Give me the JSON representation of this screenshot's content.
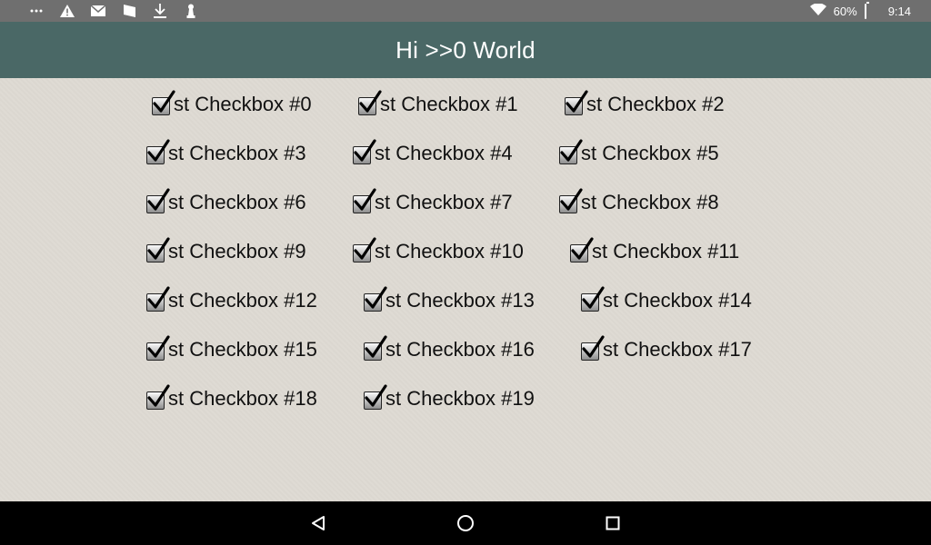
{
  "status_bar": {
    "icons_left": [
      "more-icon",
      "warning-icon",
      "mail-icon",
      "flag-icon",
      "download-icon",
      "chess-pawn-icon"
    ],
    "battery_percent": "60%",
    "time": "9:14"
  },
  "app_bar": {
    "title": "Hi >>0 World"
  },
  "checkboxes": [
    {
      "label": "st Checkbox #0",
      "checked": true
    },
    {
      "label": "st Checkbox #1",
      "checked": true
    },
    {
      "label": "st Checkbox #2",
      "checked": true
    },
    {
      "label": "st Checkbox #3",
      "checked": true
    },
    {
      "label": "st Checkbox #4",
      "checked": true
    },
    {
      "label": "st Checkbox #5",
      "checked": true
    },
    {
      "label": "st Checkbox #6",
      "checked": true
    },
    {
      "label": "st Checkbox #7",
      "checked": true
    },
    {
      "label": "st Checkbox #8",
      "checked": true
    },
    {
      "label": "st Checkbox #9",
      "checked": true
    },
    {
      "label": "st Checkbox #10",
      "checked": true
    },
    {
      "label": "st Checkbox #11",
      "checked": true
    },
    {
      "label": "st Checkbox #12",
      "checked": true
    },
    {
      "label": "st Checkbox #13",
      "checked": true
    },
    {
      "label": "st Checkbox #14",
      "checked": true
    },
    {
      "label": "st Checkbox #15",
      "checked": true
    },
    {
      "label": "st Checkbox #16",
      "checked": true
    },
    {
      "label": "st Checkbox #17",
      "checked": true
    },
    {
      "label": "st Checkbox #18",
      "checked": true
    },
    {
      "label": "st Checkbox #19",
      "checked": true
    }
  ],
  "nav_bar": {
    "icons": [
      "back-icon",
      "home-icon",
      "recents-icon"
    ]
  }
}
